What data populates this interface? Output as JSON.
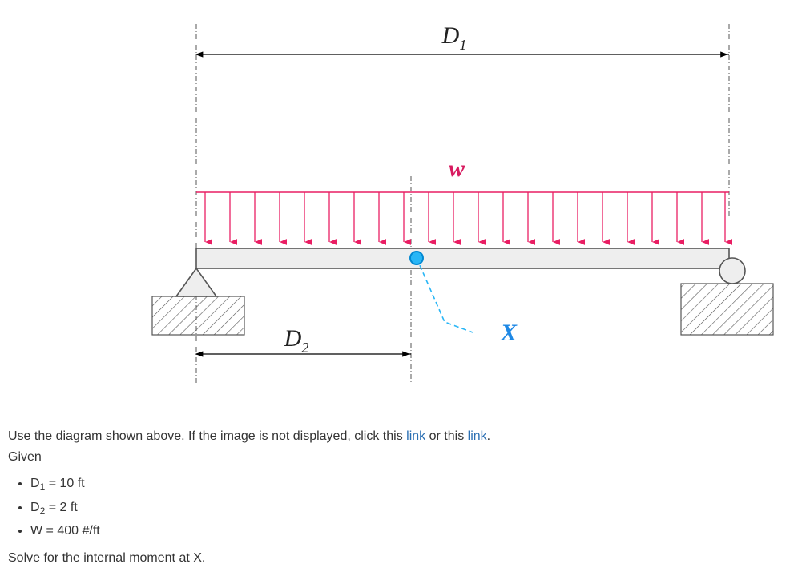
{
  "diagram": {
    "labels": {
      "D1": "D",
      "D1_sub": "1",
      "D2": "D",
      "D2_sub": "2",
      "w": "w",
      "X": "X"
    }
  },
  "text": {
    "intro_before_first_link": "Use the diagram shown above.  If the image is not displayed, click this",
    "link_space": " ",
    "link1": "link",
    "between_links": " or this ",
    "link2": "link",
    "after_links": ".",
    "given_label": "Given",
    "given_items": {
      "d1": "D",
      "d1_sub": "1",
      "d1_rest": " = 10 ft",
      "d2": "D",
      "d2_sub": "2",
      "d2_rest": " = 2 ft",
      "w": "W = 400 #/ft"
    },
    "solve": "Solve for the internal moment at X."
  }
}
